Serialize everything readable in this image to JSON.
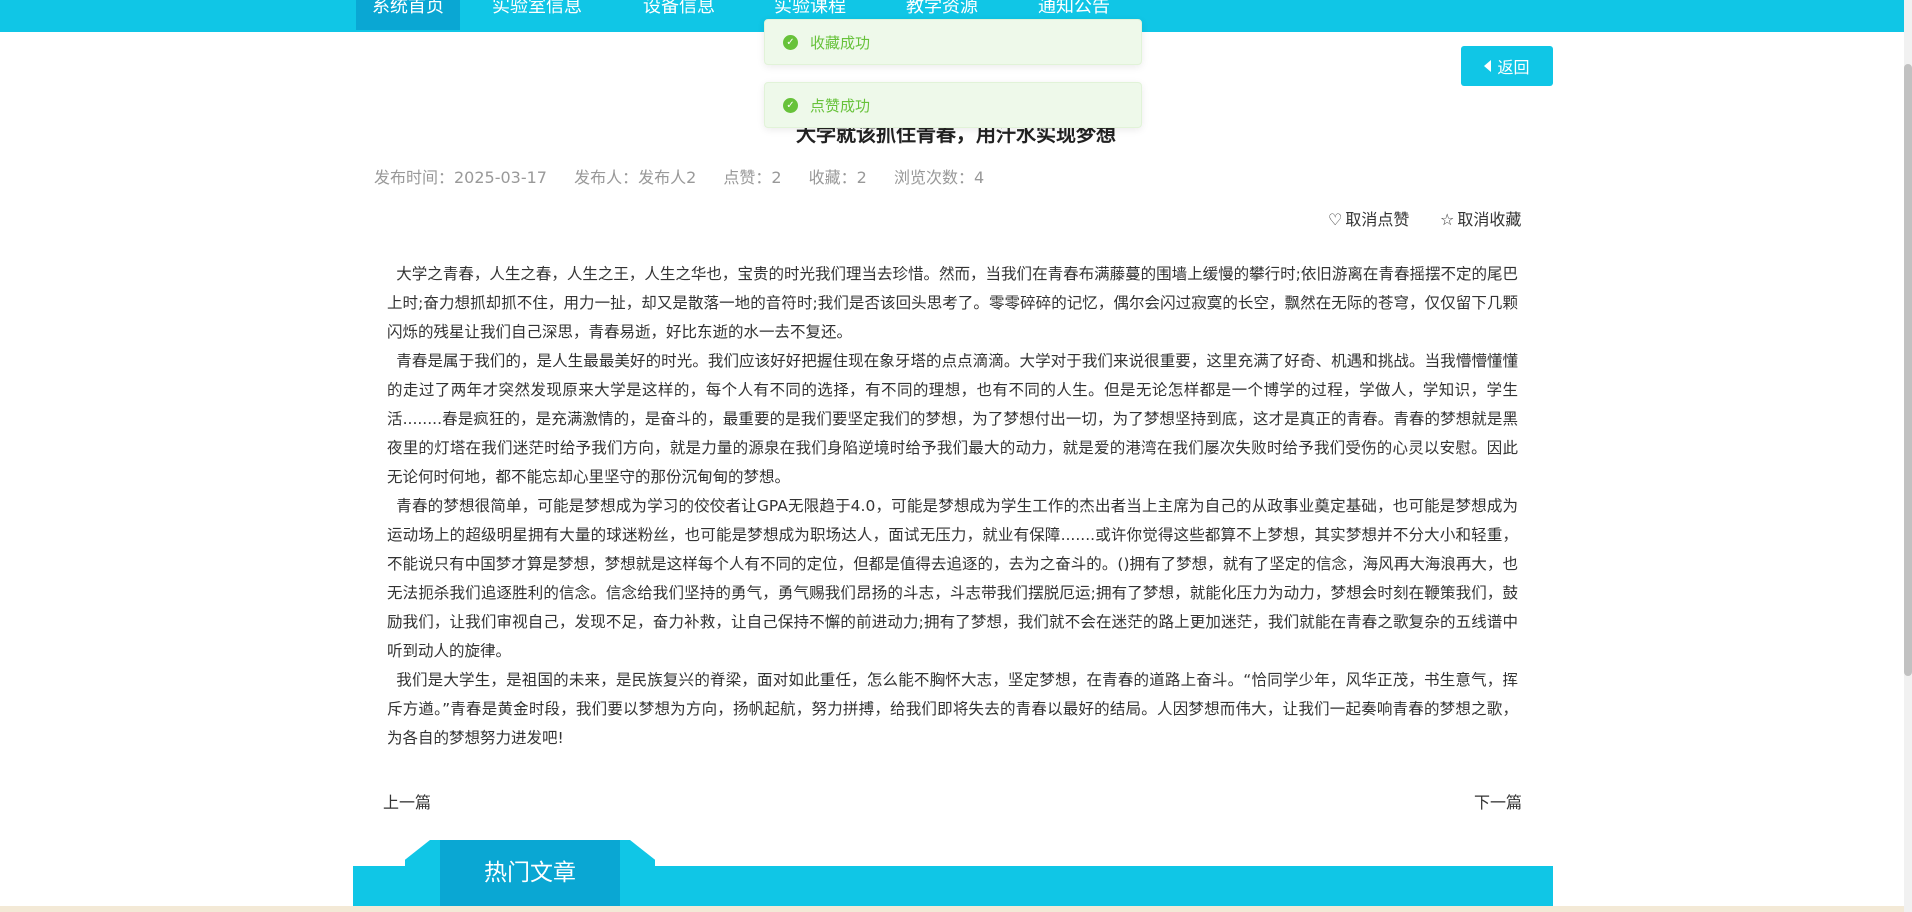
{
  "nav": {
    "items": [
      "系统首页",
      "实验室信息",
      "设备信息",
      "实验课程",
      "教学资源",
      "通知公告"
    ]
  },
  "toasts": [
    "收藏成功",
    "点赞成功"
  ],
  "back_button": "返回",
  "article": {
    "title": "大学就该抓住青春，用汗水实现梦想",
    "meta": {
      "publish_time": "发布时间：2025-03-17",
      "publisher": "发布人：发布人2",
      "likes": "点赞：2",
      "collects": "收藏：2",
      "views": "浏览次数：4"
    },
    "actions": {
      "unlike": "取消点赞",
      "uncollect": "取消收藏"
    },
    "paragraphs": [
      "大学之青春，人生之春，人生之王，人生之华也，宝贵的时光我们理当去珍惜。然而，当我们在青春布满藤蔓的围墙上缓慢的攀行时;依旧游离在青春摇摆不定的尾巴上时;奋力想抓却抓不住，用力一扯，却又是散落一地的音符时;我们是否该回头思考了。零零碎碎的记忆，偶尔会闪过寂寞的长空，飘然在无际的苍穹，仅仅留下几颗闪烁的残星让我们自己深思，青春易逝，好比东逝的水一去不复还。",
      "青春是属于我们的，是人生最最美好的时光。我们应该好好把握住现在象牙塔的点点滴滴。大学对于我们来说很重要，这里充满了好奇、机遇和挑战。当我懵懵懂懂的走过了两年才突然发现原来大学是这样的，每个人有不同的选择，有不同的理想，也有不同的人生。但是无论怎样都是一个博学的过程，学做人，学知识，学生活........春是疯狂的，是充满激情的，是奋斗的，最重要的是我们要坚定我们的梦想，为了梦想付出一切，为了梦想坚持到底，这才是真正的青春。青春的梦想就是黑夜里的灯塔在我们迷茫时给予我们方向，就是力量的源泉在我们身陷逆境时给予我们最大的动力，就是爱的港湾在我们屡次失败时给予我们受伤的心灵以安慰。因此无论何时何地，都不能忘却心里坚守的那份沉甸甸的梦想。",
      "青春的梦想很简单，可能是梦想成为学习的佼佼者让GPA无限趋于4.0，可能是梦想成为学生工作的杰出者当上主席为自己的从政事业奠定基础，也可能是梦想成为运动场上的超级明星拥有大量的球迷粉丝，也可能是梦想成为职场达人，面试无压力，就业有保障.......或许你觉得这些都算不上梦想，其实梦想并不分大小和轻重，不能说只有中国梦才算是梦想，梦想就是这样每个人有不同的定位，但都是值得去追逐的，去为之奋斗的。()拥有了梦想，就有了坚定的信念，海风再大海浪再大，也无法扼杀我们追逐胜利的信念。信念给我们坚持的勇气，勇气赐我们昂扬的斗志，斗志带我们摆脱厄运;拥有了梦想，就能化压力为动力，梦想会时刻在鞭策我们，鼓励我们，让我们审视自己，发现不足，奋力补救，让自己保持不懈的前进动力;拥有了梦想，我们就不会在迷茫的路上更加迷茫，我们就能在青春之歌复杂的五线谱中听到动人的旋律。",
      "我们是大学生，是祖国的未来，是民族复兴的脊梁，面对如此重任，怎么能不胸怀大志，坚定梦想，在青春的道路上奋斗。“恰同学少年，风华正茂，书生意气，挥斥方遒。”青春是黄金时段，我们要以梦想为方向，扬帆起航，努力拼搏，给我们即将失去的青春以最好的结局。人因梦想而伟大，让我们一起奏响青春的梦想之歌，为各自的梦想努力进发吧!"
    ],
    "prev": "上一篇",
    "next": "下一篇"
  },
  "hot_articles_title": "热门文章",
  "colors": {
    "accent": "#10c6e6",
    "accent_dark": "#0aa7d3",
    "success": "#67c23a"
  },
  "icons": {
    "toast": "check-circle-icon",
    "back": "caret-left-icon",
    "unlike": "heart-icon",
    "uncollect": "star-icon"
  }
}
